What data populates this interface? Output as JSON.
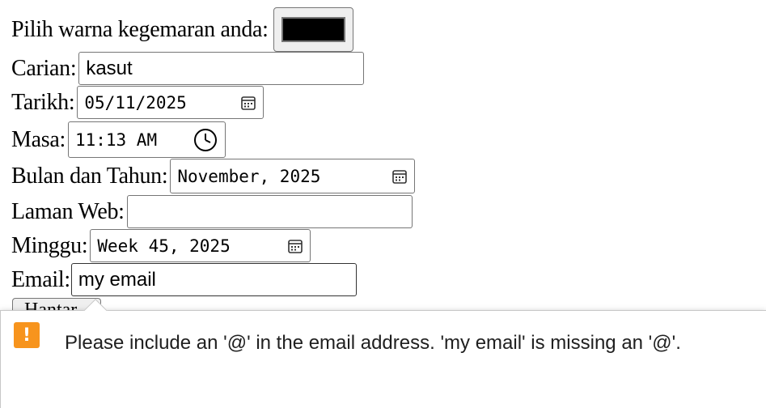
{
  "form": {
    "color": {
      "label": "Pilih warna kegemaran anda:",
      "value": "#000000"
    },
    "search": {
      "label": "Carian:",
      "value": "kasut"
    },
    "date": {
      "label": "Tarikh:",
      "value": "05/11/2025",
      "icon": "calendar-icon"
    },
    "time": {
      "label": "Masa:",
      "value": "11:13 AM",
      "icon": "clock-icon"
    },
    "month": {
      "label": "Bulan dan Tahun:",
      "value": "November, 2025",
      "icon": "calendar-icon"
    },
    "url": {
      "label": "Laman Web:",
      "value": ""
    },
    "week": {
      "label": "Minggu:",
      "value": "Week 45, 2025",
      "icon": "calendar-icon"
    },
    "email": {
      "label": "Email:",
      "value": "my email"
    },
    "submit": {
      "label": "Hantar"
    }
  },
  "validation_tooltip": {
    "icon": "warning-icon",
    "icon_glyph": "!",
    "icon_color": "#f7941d",
    "message": "Please include an '@' in the email address. 'my email' is missing an '@'."
  }
}
